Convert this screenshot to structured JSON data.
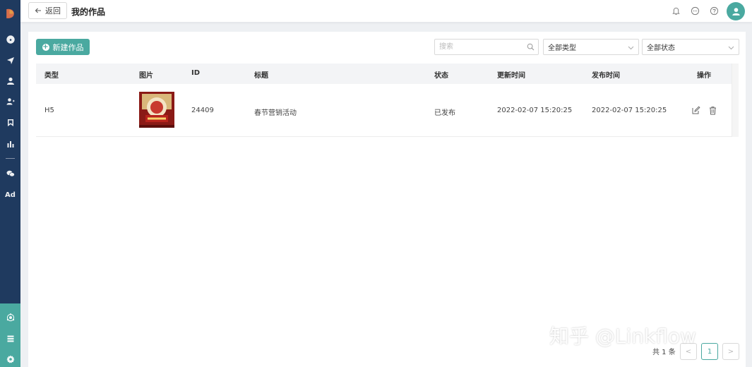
{
  "header": {
    "back_label": "返回",
    "title": "我的作品",
    "icons": [
      "bell-icon",
      "message-icon",
      "help-icon",
      "user-avatar-icon"
    ]
  },
  "sidebar": {
    "icons": [
      "logo-icon",
      "dashboard-icon",
      "send-icon",
      "user-icon",
      "users-icon",
      "bookmark-icon",
      "bar-chart-icon",
      "wechat-icon",
      "ad-icon",
      "network-icon",
      "list-icon",
      "gear-icon"
    ],
    "ad_label": "Ad"
  },
  "toolbar": {
    "new_label": "新建作品",
    "search_placeholder": "搜索",
    "type_select": "全部类型",
    "status_select": "全部状态"
  },
  "table": {
    "headers": {
      "type": "类型",
      "image": "图片",
      "id": "ID",
      "title": "标题",
      "status": "状态",
      "updated": "更新时间",
      "published": "发布时间",
      "actions": "操作"
    },
    "rows": [
      {
        "type": "H5",
        "id": "24409",
        "title": "春节营销活动",
        "status": "已发布",
        "updated": "2022-02-07 15:20:25",
        "published": "2022-02-07 15:20:25"
      }
    ]
  },
  "pagination": {
    "total": "共 1 条",
    "current": "1",
    "prev": "<",
    "next": ">"
  },
  "watermark": "知乎 @Linkflow",
  "colors": {
    "sidebar": "#1f3a5f",
    "accent": "#4aa9a0"
  }
}
